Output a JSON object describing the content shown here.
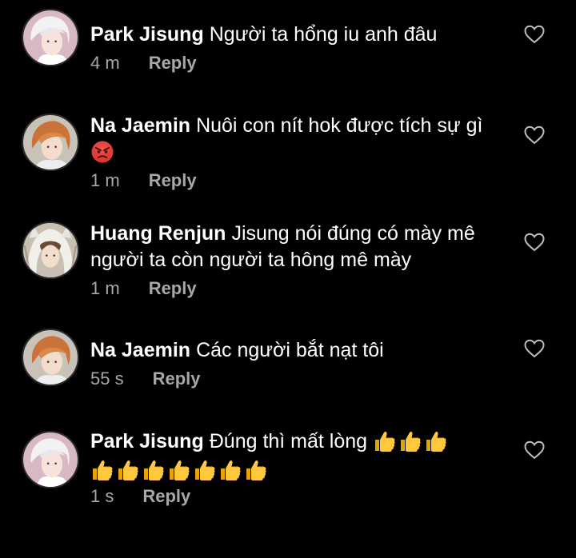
{
  "comments": [
    {
      "author": "Park Jisung",
      "text": "Người ta hổng iu anh đâu",
      "time": "4 m",
      "reply_label": "Reply",
      "avatar_icon": "avatar-silver-hair",
      "emojis": []
    },
    {
      "author": "Na Jaemin",
      "text": "Nuôi con nít hok được tích sự gì",
      "time": "1 m",
      "reply_label": "Reply",
      "avatar_icon": "avatar-orange-hair",
      "emojis": [
        "angry-face"
      ]
    },
    {
      "author": "Huang Renjun",
      "text": "Jisung nói đúng có mày mê người ta còn người ta hông mê mày",
      "time": "1 m",
      "reply_label": "Reply",
      "avatar_icon": "avatar-bunny-hood",
      "emojis": []
    },
    {
      "author": "Na Jaemin",
      "text": "Các người bắt nạt tôi",
      "time": "55 s",
      "reply_label": "Reply",
      "avatar_icon": "avatar-orange-hair",
      "emojis": []
    },
    {
      "author": "Park Jisung",
      "text": "Đúng thì mất lòng",
      "time": "1 s",
      "reply_label": "Reply",
      "avatar_icon": "avatar-silver-hair",
      "emojis": [
        "thumbs-up",
        "thumbs-up",
        "thumbs-up",
        "thumbs-up",
        "thumbs-up",
        "thumbs-up",
        "thumbs-up",
        "thumbs-up",
        "thumbs-up",
        "thumbs-up"
      ]
    }
  ],
  "colors": {
    "background": "#000000",
    "text": "#ffffff",
    "muted": "#a8a8a8"
  }
}
